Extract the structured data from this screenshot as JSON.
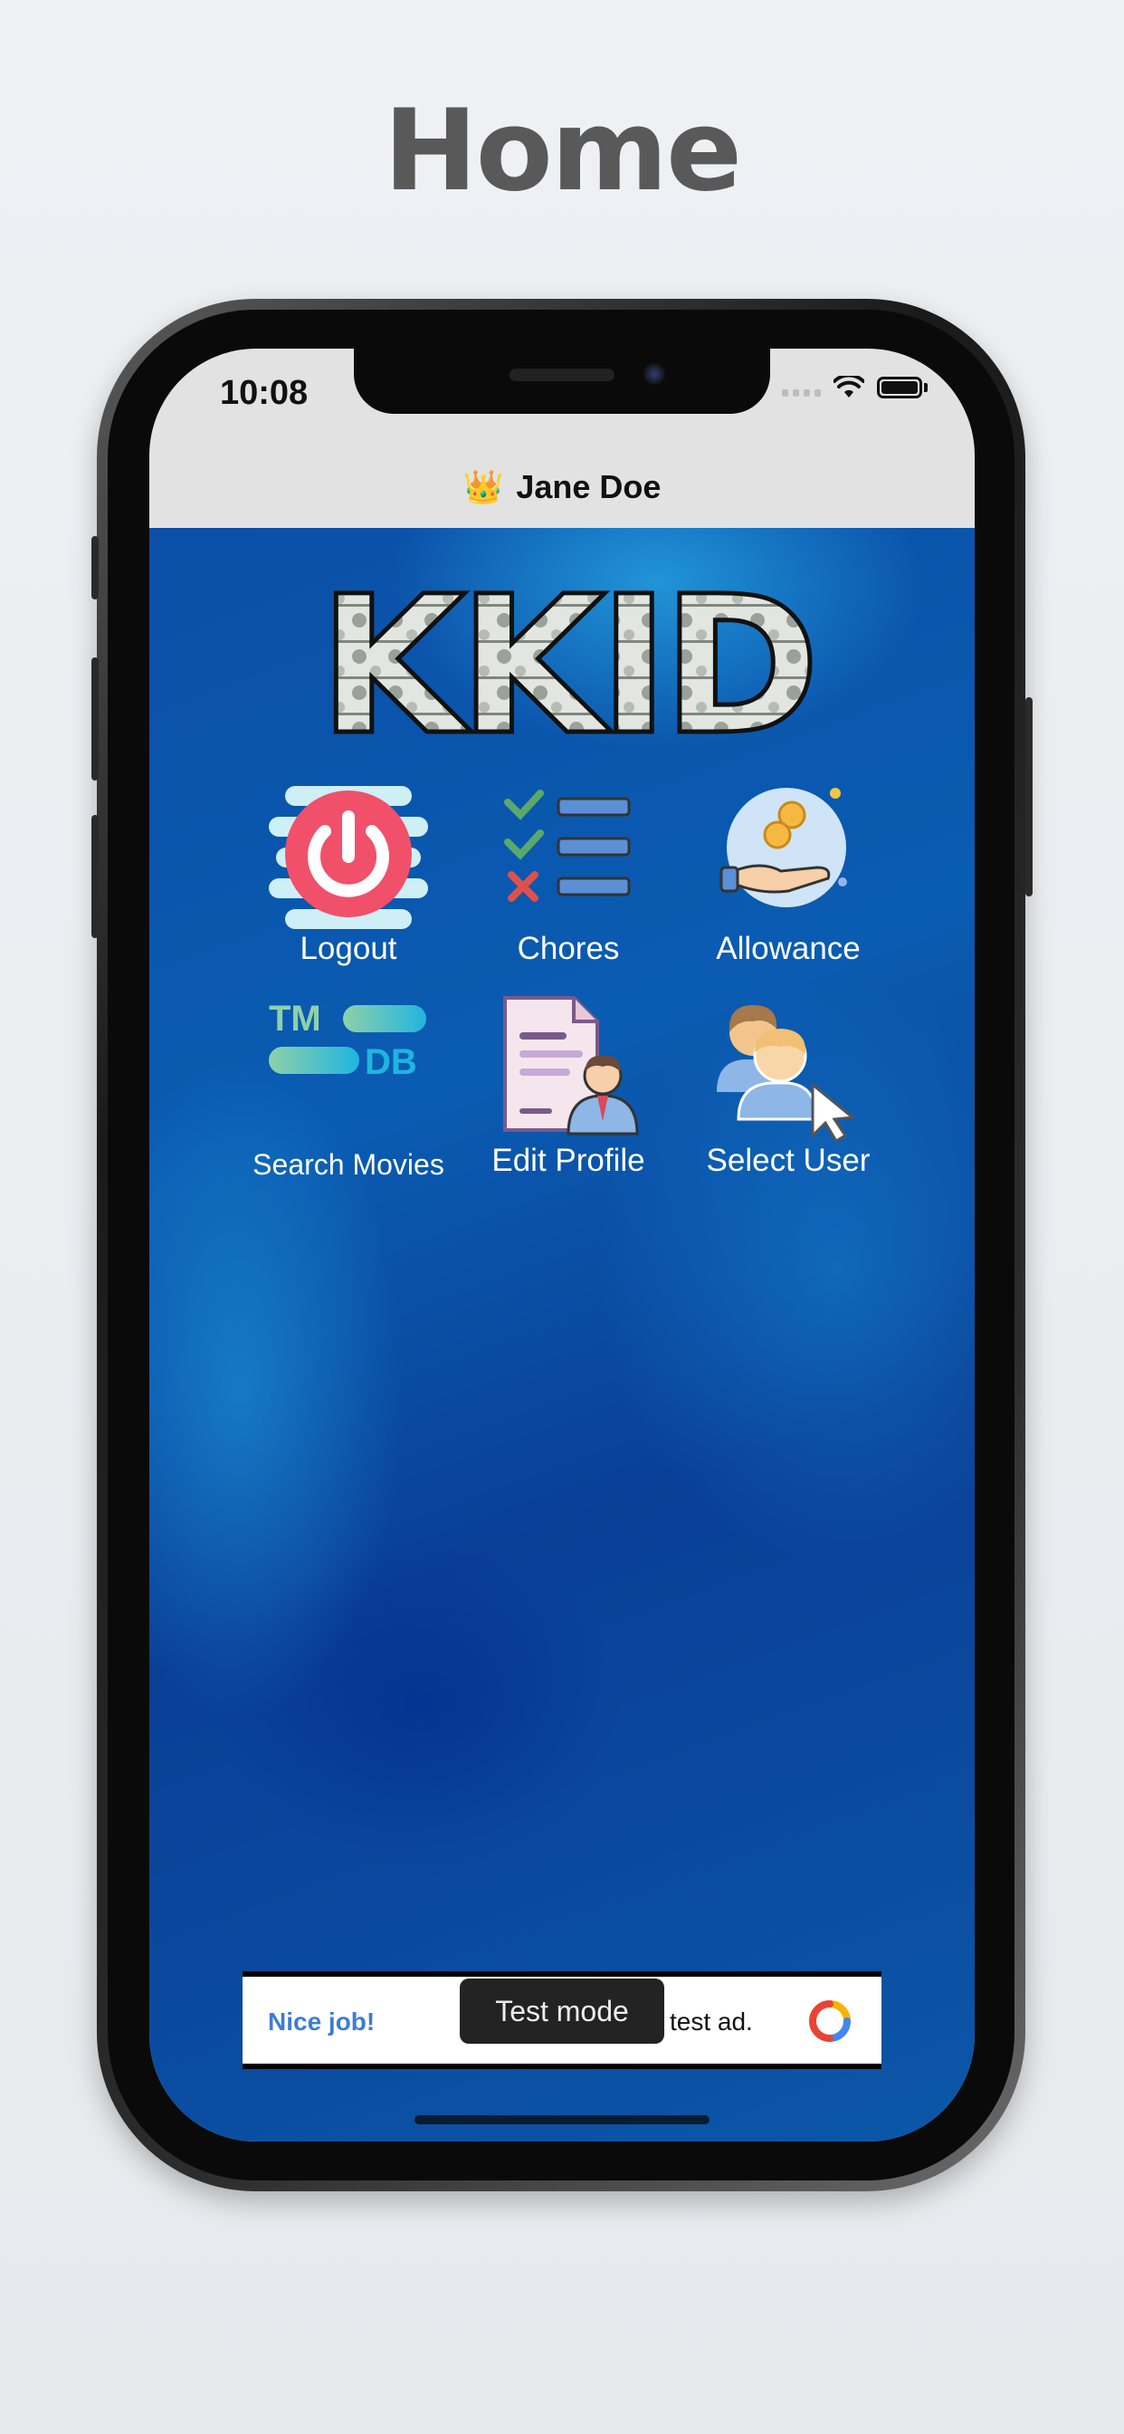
{
  "page": {
    "title": "Home"
  },
  "status_bar": {
    "time": "10:08"
  },
  "nav": {
    "emoji": "👑",
    "user_name": "Jane Doe"
  },
  "logo": {
    "text": "KKID"
  },
  "menu": {
    "logout": "Logout",
    "chores": "Chores",
    "allowance": "Allowance",
    "search_movies": "Search Movies",
    "edit_profile": "Edit Profile",
    "select_user": "Select User",
    "tmdb_top": "TM",
    "tmdb_bottom": "DB"
  },
  "ad": {
    "left_text": "Nice job!",
    "badge": "Test mode",
    "right_text": "test ad."
  },
  "colors": {
    "accent_blue": "#3d7cd6",
    "power_red": "#f0506a",
    "tmdb_green": "#8fd0a8",
    "tmdb_blue": "#1fb5e0"
  }
}
